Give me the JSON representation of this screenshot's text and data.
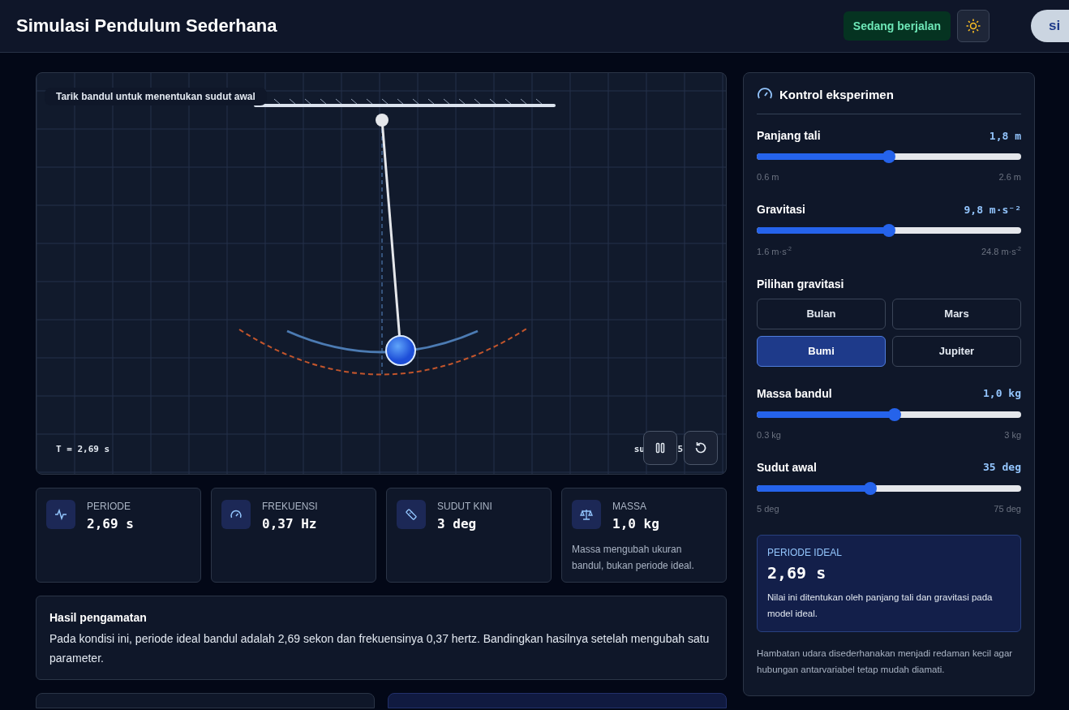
{
  "header": {
    "title": "Simulasi Pendulum Sederhana",
    "status": "Sedang berjalan",
    "running": true,
    "cut_pill": "si"
  },
  "canvas": {
    "hint": "Tarik bandul untuk menentukan sudut awal",
    "period_readout": "T = 2,69 s",
    "angle_readout_parts": [
      "su",
      "5"
    ],
    "paused": false
  },
  "stats": [
    {
      "label": "PERIODE",
      "value": "2,69 s"
    },
    {
      "label": "FREKUENSI",
      "value": "0,37 Hz"
    },
    {
      "label": "SUDUT KINI",
      "value": "3 deg"
    },
    {
      "label": "MASSA",
      "value": "1,0 kg",
      "note": "Massa mengubah ukuran bandul, bukan periode ideal."
    }
  ],
  "observation": {
    "title": "Hasil pengamatan",
    "text": "Pada kondisi ini, periode ideal bandul adalah 2,69 sekon dan frekuensinya 0,37 hertz. Bandingkan hasilnya setelah mengubah satu parameter."
  },
  "controls": {
    "title": "Kontrol eksperimen",
    "items": [
      {
        "kind": "slider",
        "label": "Panjang tali",
        "reading": "1,8 m",
        "level": 0.5,
        "min": "0.6 m",
        "max": "2.6 m"
      },
      {
        "kind": "slider",
        "label": "Gravitasi",
        "reading": "9,8 m·s⁻²",
        "level": 0.5,
        "min": "1.6 m·s$^{-2}$",
        "max": "24.8 m·s$^{-2}$"
      },
      {
        "kind": "presets",
        "label": "Pilihan gravitasi",
        "options": [
          {
            "label": "Bulan",
            "selected": false
          },
          {
            "label": "Mars",
            "selected": false
          },
          {
            "label": "Bumi",
            "selected": true
          },
          {
            "label": "Jupiter",
            "selected": false
          }
        ]
      },
      {
        "kind": "slider",
        "label": "Massa bandul",
        "reading": "1,0 kg",
        "level": 0.52,
        "min": "0.3 kg",
        "max": "3 kg"
      },
      {
        "kind": "slider",
        "label": "Sudut awal",
        "reading": "35 deg",
        "level": 0.43,
        "min": "5 deg",
        "max": "75 deg"
      }
    ],
    "ideal": {
      "label": "PERIODE IDEAL",
      "value": "2,69 s",
      "note": "Nilai ini ditentukan oleh panjang tali dan gravitasi pada model ideal."
    },
    "footnote": "Hambatan udara disederhanakan menjadi redaman kecil agar hubungan antarvariabel tetap mudah diamati."
  }
}
